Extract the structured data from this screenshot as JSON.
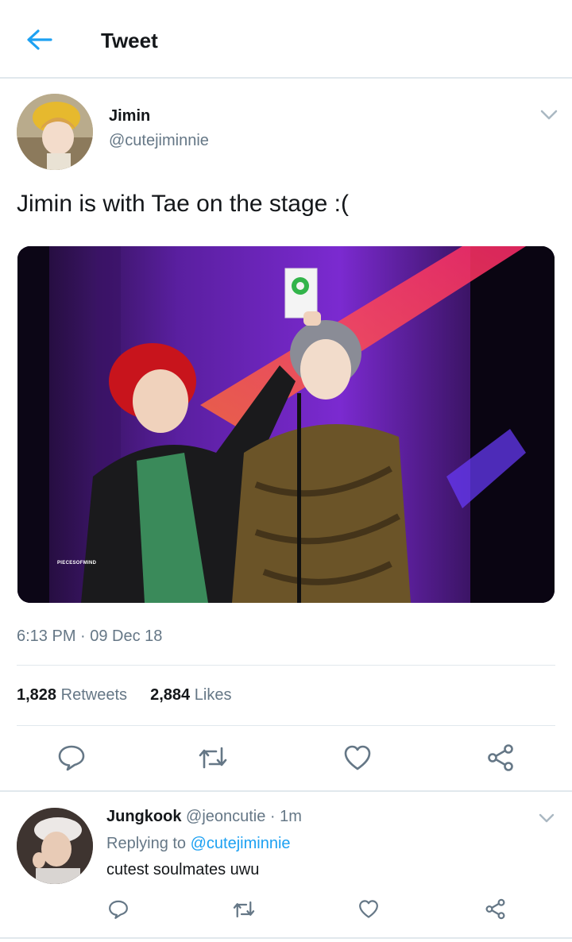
{
  "header": {
    "title": "Tweet"
  },
  "tweet": {
    "author_name": "Jimin",
    "author_handle": "@cutejiminnie",
    "text": "Jimin is with Tae on the stage :(",
    "image_watermark": "PIECESOFMIND",
    "timestamp": "6:13 PM · 09 Dec 18",
    "retweets_count": "1,828",
    "retweets_label": "Retweets",
    "likes_count": "2,884",
    "likes_label": "Likes"
  },
  "reply": {
    "author_name": "Jungkook",
    "author_handle_time": "@jeoncutie · 1m",
    "replying_prefix": "Replying to",
    "replying_to": "@cutejiminnie",
    "text": "cutest soulmates uwu"
  },
  "icons": {
    "back": "arrow-left-icon",
    "more": "chevron-down-icon",
    "reply": "comment-icon",
    "retweet": "retweet-icon",
    "like": "heart-icon",
    "share": "share-icon"
  },
  "colors": {
    "accent": "#1da1f2",
    "secondary_text": "#657786",
    "divider": "#e1e8ed"
  }
}
